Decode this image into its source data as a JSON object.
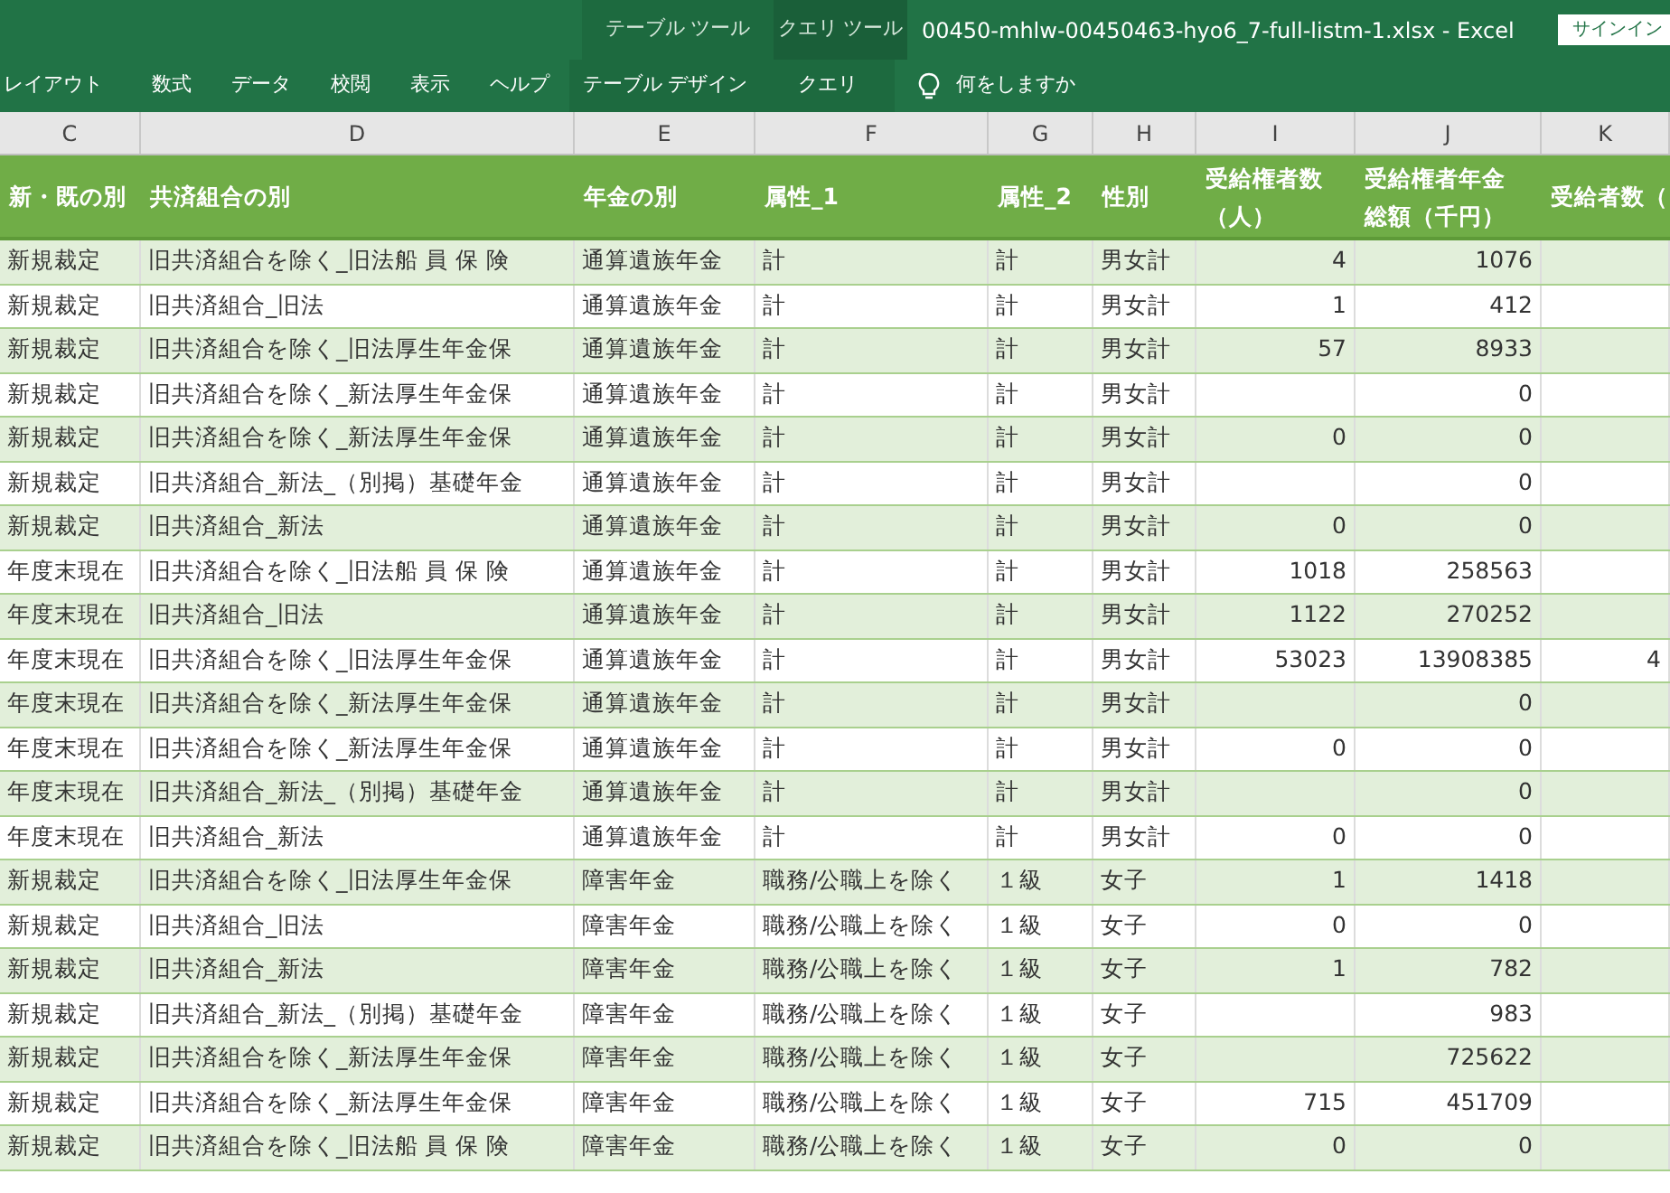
{
  "window": {
    "contextual_groups": [
      {
        "label": "テーブル ツール"
      },
      {
        "label": "クエリ ツール"
      }
    ],
    "title": "00450-mhlw-00450463-hyo6_7-full-listm-1.xlsx  -  Excel",
    "signin": "サインイン"
  },
  "ribbon_tabs": [
    {
      "label": "レイアウト",
      "kind": "normal"
    },
    {
      "label": "数式",
      "kind": "normal"
    },
    {
      "label": "データ",
      "kind": "normal"
    },
    {
      "label": "校閲",
      "kind": "normal"
    },
    {
      "label": "表示",
      "kind": "normal"
    },
    {
      "label": "ヘルプ",
      "kind": "normal"
    },
    {
      "label": "テーブル デザイン",
      "kind": "contextual"
    },
    {
      "label": "クエリ",
      "kind": "contextual"
    }
  ],
  "tell_me": "何をしますか",
  "columns": [
    {
      "letter": "C",
      "header": "新・既の別"
    },
    {
      "letter": "D",
      "header": "共済組合の別"
    },
    {
      "letter": "E",
      "header": "年金の別"
    },
    {
      "letter": "F",
      "header": "属性_1"
    },
    {
      "letter": "G",
      "header": "属性_2"
    },
    {
      "letter": "H",
      "header": "性別"
    },
    {
      "letter": "I",
      "header": "受給権者数（人）"
    },
    {
      "letter": "J",
      "header": "受給権者年金総額（千円）"
    },
    {
      "letter": "K",
      "header": "受給者数（"
    }
  ],
  "rows": [
    {
      "C": "新規裁定",
      "D": "旧共済組合を除く_旧法船 員 保 険",
      "E": "通算遺族年金",
      "F": "計",
      "G": "計",
      "H": "男女計",
      "I": "4",
      "J": "1076"
    },
    {
      "C": "新規裁定",
      "D": "旧共済組合_旧法",
      "E": "通算遺族年金",
      "F": "計",
      "G": "計",
      "H": "男女計",
      "I": "1",
      "J": "412"
    },
    {
      "C": "新規裁定",
      "D": "旧共済組合を除く_旧法厚生年金保",
      "E": "通算遺族年金",
      "F": "計",
      "G": "計",
      "H": "男女計",
      "I": "57",
      "J": "8933"
    },
    {
      "C": "新規裁定",
      "D": "旧共済組合を除く_新法厚生年金保",
      "E": "通算遺族年金",
      "F": "計",
      "G": "計",
      "H": "男女計",
      "J": "0"
    },
    {
      "C": "新規裁定",
      "D": "旧共済組合を除く_新法厚生年金保",
      "E": "通算遺族年金",
      "F": "計",
      "G": "計",
      "H": "男女計",
      "I": "0",
      "J": "0"
    },
    {
      "C": "新規裁定",
      "D": "旧共済組合_新法_（別掲）基礎年金",
      "E": "通算遺族年金",
      "F": "計",
      "G": "計",
      "H": "男女計",
      "J": "0"
    },
    {
      "C": "新規裁定",
      "D": "旧共済組合_新法",
      "E": "通算遺族年金",
      "F": "計",
      "G": "計",
      "H": "男女計",
      "I": "0",
      "J": "0"
    },
    {
      "C": "年度末現在",
      "D": "旧共済組合を除く_旧法船 員 保 険",
      "E": "通算遺族年金",
      "F": "計",
      "G": "計",
      "H": "男女計",
      "I": "1018",
      "J": "258563"
    },
    {
      "C": "年度末現在",
      "D": "旧共済組合_旧法",
      "E": "通算遺族年金",
      "F": "計",
      "G": "計",
      "H": "男女計",
      "I": "1122",
      "J": "270252"
    },
    {
      "C": "年度末現在",
      "D": "旧共済組合を除く_旧法厚生年金保",
      "E": "通算遺族年金",
      "F": "計",
      "G": "計",
      "H": "男女計",
      "I": "53023",
      "J": "13908385",
      "K": "4"
    },
    {
      "C": "年度末現在",
      "D": "旧共済組合を除く_新法厚生年金保",
      "E": "通算遺族年金",
      "F": "計",
      "G": "計",
      "H": "男女計",
      "J": "0"
    },
    {
      "C": "年度末現在",
      "D": "旧共済組合を除く_新法厚生年金保",
      "E": "通算遺族年金",
      "F": "計",
      "G": "計",
      "H": "男女計",
      "I": "0",
      "J": "0"
    },
    {
      "C": "年度末現在",
      "D": "旧共済組合_新法_（別掲）基礎年金",
      "E": "通算遺族年金",
      "F": "計",
      "G": "計",
      "H": "男女計",
      "J": "0"
    },
    {
      "C": "年度末現在",
      "D": "旧共済組合_新法",
      "E": "通算遺族年金",
      "F": "計",
      "G": "計",
      "H": "男女計",
      "I": "0",
      "J": "0"
    },
    {
      "C": "新規裁定",
      "D": "旧共済組合を除く_旧法厚生年金保",
      "E": "障害年金",
      "F": "職務/公職上を除く",
      "G": "１級",
      "H": "女子",
      "I": "1",
      "J": "1418"
    },
    {
      "C": "新規裁定",
      "D": "旧共済組合_旧法",
      "E": "障害年金",
      "F": "職務/公職上を除く",
      "G": "１級",
      "H": "女子",
      "I": "0",
      "J": "0"
    },
    {
      "C": "新規裁定",
      "D": "旧共済組合_新法",
      "E": "障害年金",
      "F": "職務/公職上を除く",
      "G": "１級",
      "H": "女子",
      "I": "1",
      "J": "782"
    },
    {
      "C": "新規裁定",
      "D": "旧共済組合_新法_（別掲）基礎年金",
      "E": "障害年金",
      "F": "職務/公職上を除く",
      "G": "１級",
      "H": "女子",
      "J": "983"
    },
    {
      "C": "新規裁定",
      "D": "旧共済組合を除く_新法厚生年金保",
      "E": "障害年金",
      "F": "職務/公職上を除く",
      "G": "１級",
      "H": "女子",
      "J": "725622"
    },
    {
      "C": "新規裁定",
      "D": "旧共済組合を除く_新法厚生年金保",
      "E": "障害年金",
      "F": "職務/公職上を除く",
      "G": "１級",
      "H": "女子",
      "I": "715",
      "J": "451709"
    },
    {
      "C": "新規裁定",
      "D": "旧共済組合を除く_旧法船 員 保 険",
      "E": "障害年金",
      "F": "職務/公職上を除く",
      "G": "１級",
      "H": "女子",
      "I": "0",
      "J": "0"
    }
  ]
}
